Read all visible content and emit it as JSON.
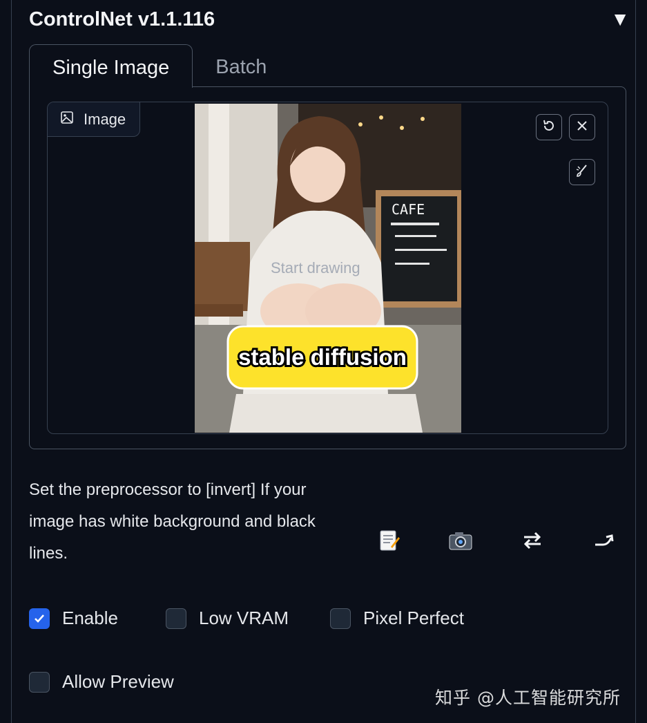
{
  "header": {
    "title": "ControlNet v1.1.116",
    "collapse_icon": "triangle-down-icon"
  },
  "tabs": [
    {
      "label": "Single Image",
      "active": true
    },
    {
      "label": "Batch",
      "active": false
    }
  ],
  "image_panel": {
    "label": "Image",
    "label_icon": "image-icon",
    "canvas_placeholder": "Start drawing",
    "overlay_caption": "stable diffusion",
    "chalkboard_text": "CAFE",
    "tools": [
      "undo-icon",
      "close-icon",
      "brush-icon"
    ]
  },
  "help_text": "Set the preprocessor to [invert] If your image has white background and black lines.",
  "action_icons": [
    "memo-icon",
    "camera-icon",
    "swap-icon",
    "send-icon"
  ],
  "checkboxes": [
    {
      "label": "Enable",
      "checked": true
    },
    {
      "label": "Low VRAM",
      "checked": false
    },
    {
      "label": "Pixel Perfect",
      "checked": false
    },
    {
      "label": "Allow Preview",
      "checked": false
    }
  ],
  "watermark": "知乎 @人工智能研究所",
  "colors": {
    "background": "#0b0f19",
    "accent": "#2563eb",
    "caption_yellow": "#fde22b"
  }
}
